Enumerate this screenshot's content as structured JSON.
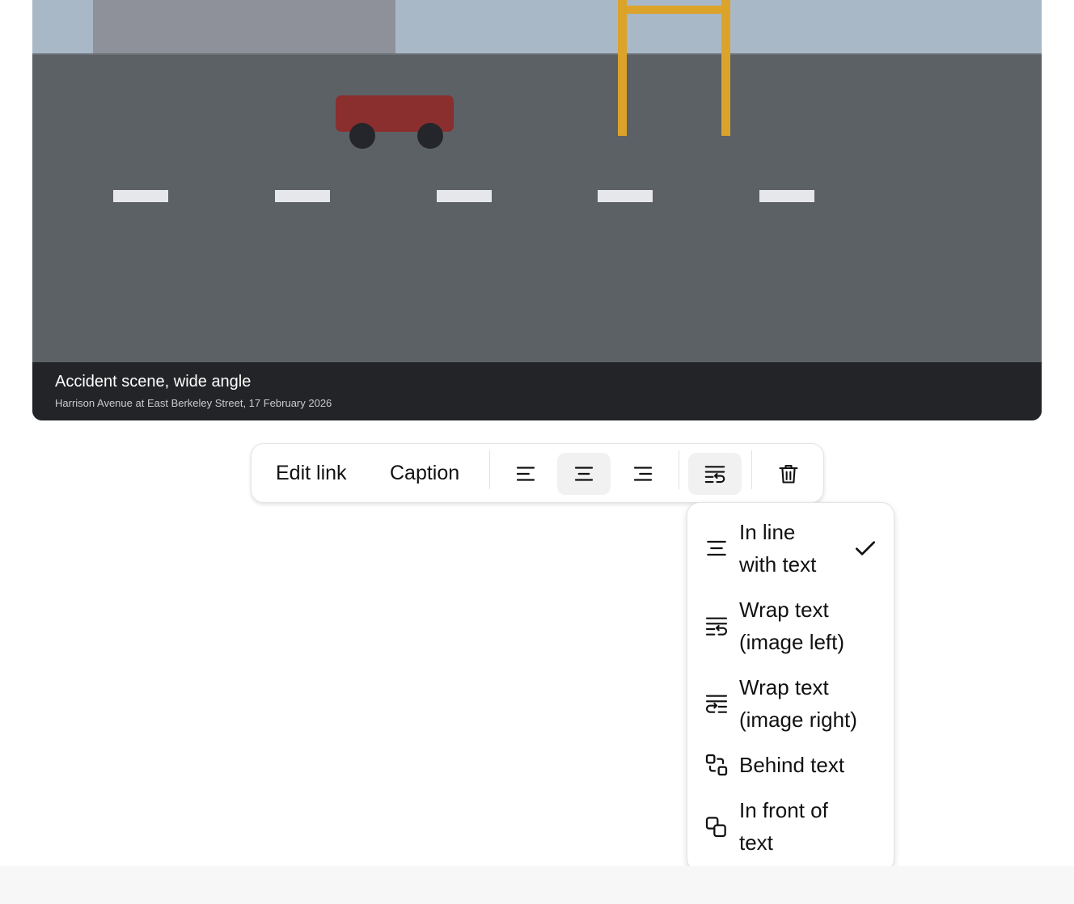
{
  "figure": {
    "caption_title": "Accident scene, wide angle",
    "caption_subtitle": "Harrison Avenue at East Berkeley Street, 17 February 2026",
    "colors": {
      "sky": "#a9b8c6",
      "building": "#8e9199",
      "road": "#5c6166",
      "car": "#8b2e2e",
      "wheel": "#24262b",
      "sign": "#dca32a",
      "lane": "#e6e7ea",
      "caption_bg": "#222427"
    }
  },
  "toolbar": {
    "edit_link_label": "Edit link",
    "caption_label": "Caption",
    "icons": [
      "align-left-icon",
      "align-center-icon",
      "align-right-icon",
      "text-wrap-icon",
      "trash-icon"
    ],
    "active_alignment": "center"
  },
  "wrap_menu": {
    "items": [
      {
        "label": "In line\nwith text",
        "icon": "inline-text-icon",
        "selected": true
      },
      {
        "label": "Wrap text\n(image left)",
        "icon": "wrap-left-icon",
        "selected": false
      },
      {
        "label": "Wrap text\n(image right)",
        "icon": "wrap-right-icon",
        "selected": false
      },
      {
        "label": "Behind text",
        "icon": "behind-text-icon",
        "selected": false
      },
      {
        "label": "In front of\ntext",
        "icon": "front-text-icon",
        "selected": false
      }
    ]
  }
}
